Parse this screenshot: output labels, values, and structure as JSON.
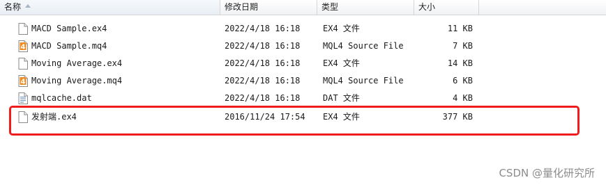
{
  "columns": {
    "name": "名称",
    "date": "修改日期",
    "type": "类型",
    "size": "大小"
  },
  "files": [
    {
      "name": "MACD Sample.ex4",
      "date": "2022/4/18 16:18",
      "type": "EX4 文件",
      "size": "11 KB",
      "icon": "blank-file-icon"
    },
    {
      "name": "MACD Sample.mq4",
      "date": "2022/4/18 16:18",
      "type": "MQL4 Source File",
      "size": "7 KB",
      "icon": "mql4-file-icon"
    },
    {
      "name": "Moving Average.ex4",
      "date": "2022/4/18 16:18",
      "type": "EX4 文件",
      "size": "14 KB",
      "icon": "blank-file-icon"
    },
    {
      "name": "Moving Average.mq4",
      "date": "2022/4/18 16:18",
      "type": "MQL4 Source File",
      "size": "6 KB",
      "icon": "mql4-file-icon"
    },
    {
      "name": "mqlcache.dat",
      "date": "2022/4/18 16:18",
      "type": "DAT 文件",
      "size": "4 KB",
      "icon": "dat-file-icon"
    },
    {
      "name": "发射端.ex4",
      "date": "2016/11/24 17:54",
      "type": "EX4 文件",
      "size": "377 KB",
      "icon": "blank-file-icon"
    }
  ],
  "highlight_color": "#ee1c1c",
  "watermark": "CSDN @量化研究所"
}
